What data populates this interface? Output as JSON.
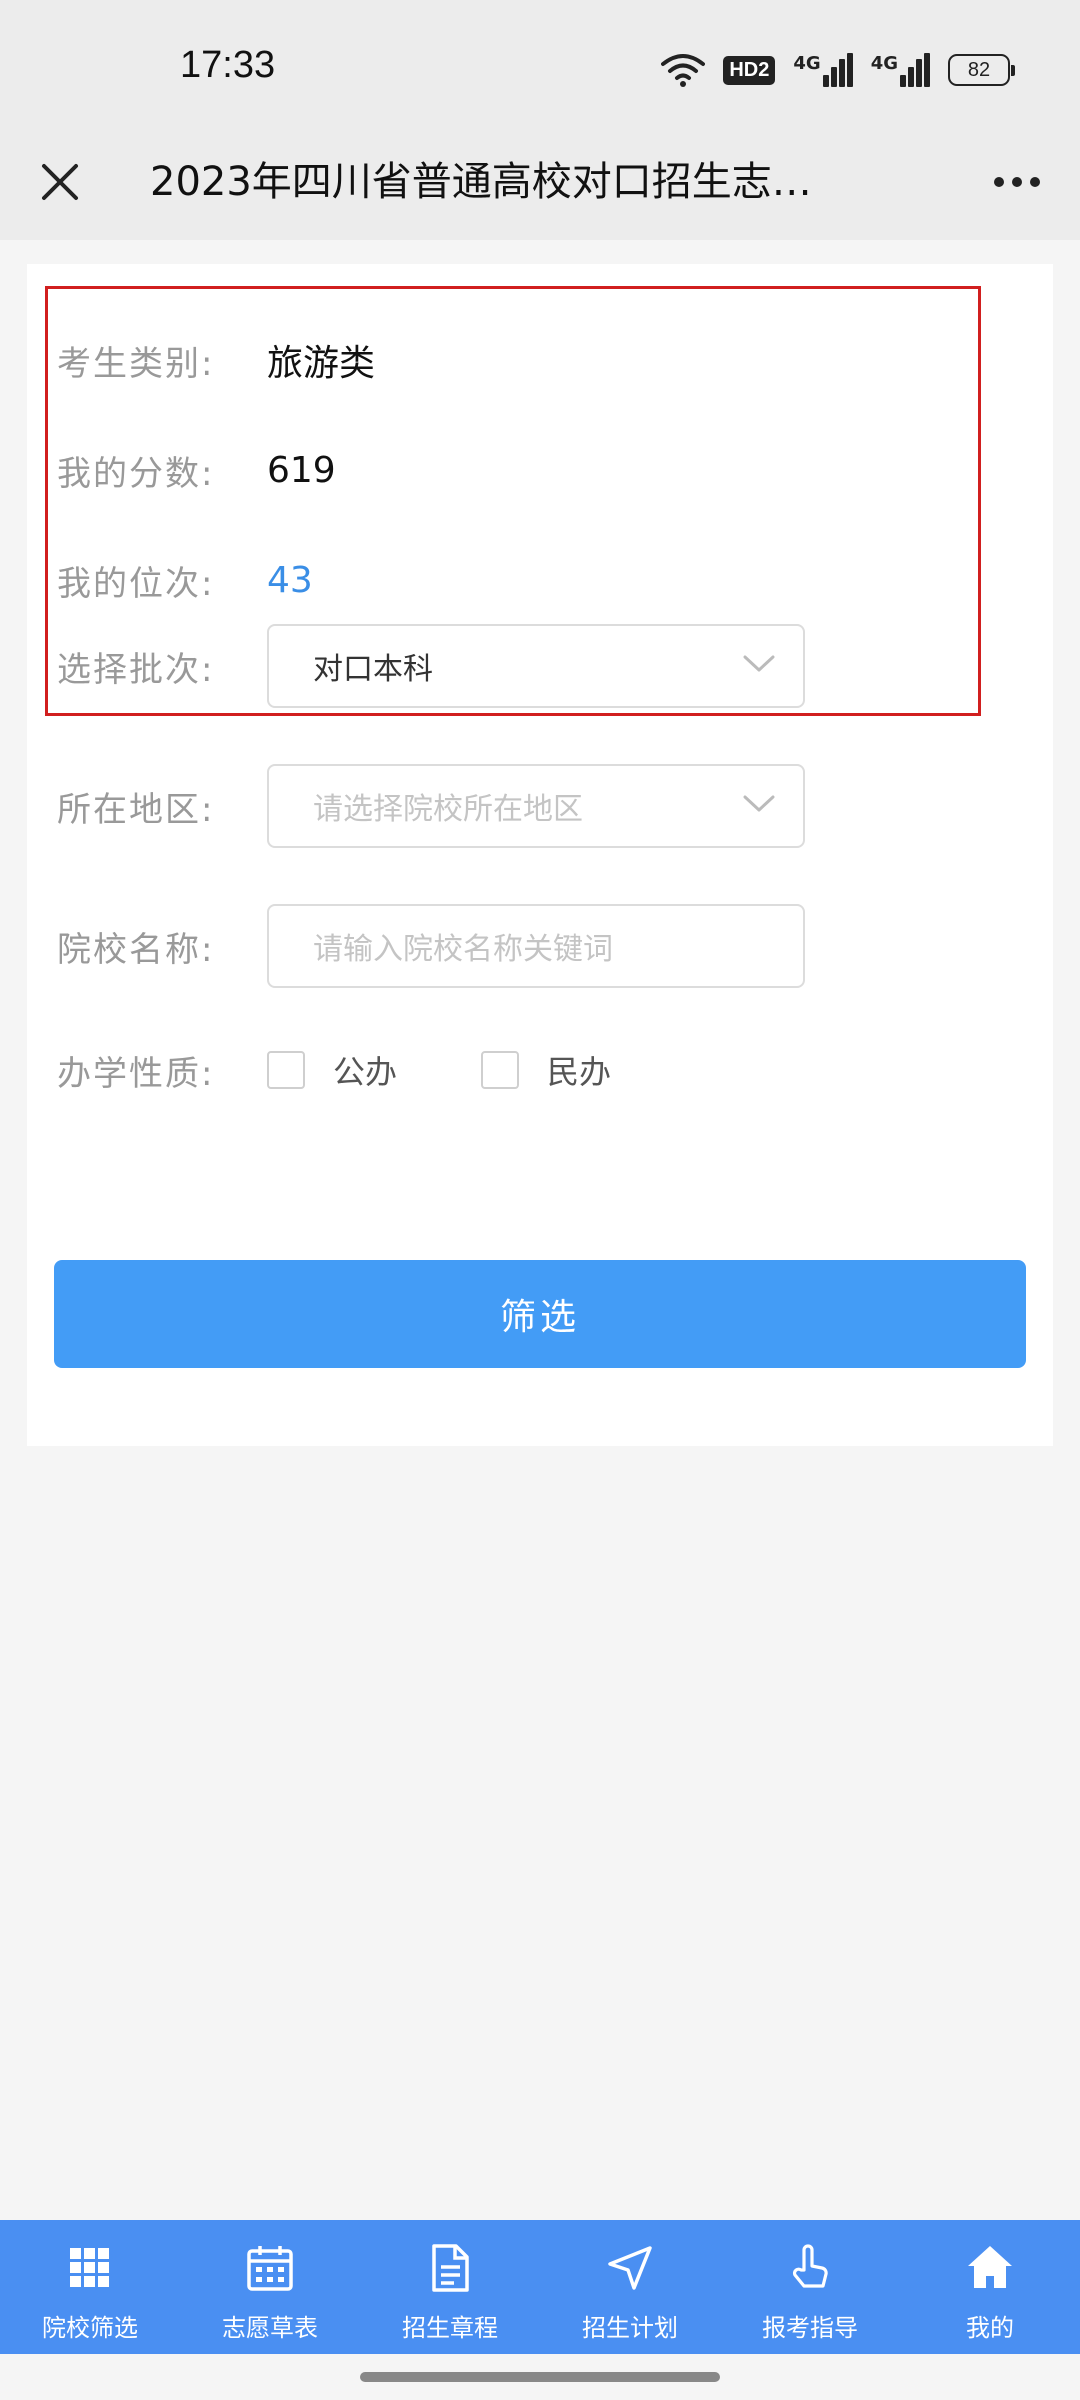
{
  "status_bar": {
    "time": "17:33",
    "hd_label": "HD2",
    "network_1": "4G",
    "network_2": "4G",
    "battery": "82",
    "icons": [
      "wifi-icon",
      "hd-icon",
      "signal-icon",
      "signal-icon",
      "battery-icon"
    ]
  },
  "header": {
    "title": "2023年四川省普通高校对口招生志…",
    "close_icon": "close-icon",
    "more_icon": "more-icon"
  },
  "form": {
    "category_label": "考生类别:",
    "category_value": "旅游类",
    "score_label": "我的分数:",
    "score_value": "619",
    "rank_label": "我的位次:",
    "rank_value": "43",
    "batch_label": "选择批次:",
    "batch_value": "对口本科",
    "region_label": "所在地区:",
    "region_placeholder": "请选择院校所在地区",
    "school_label": "院校名称:",
    "school_placeholder": "请输入院校名称关键词",
    "nature_label": "办学性质:",
    "public_label": "公办",
    "private_label": "民办",
    "submit_label": "筛选"
  },
  "colors": {
    "accent": "#439cf6",
    "nav": "#4a8ff2",
    "highlight": "#d11f1f",
    "rank": "#3a8ee6"
  },
  "nav": {
    "items": [
      {
        "label": "院校筛选",
        "icon": "grid-icon"
      },
      {
        "label": "志愿草表",
        "icon": "calendar-icon"
      },
      {
        "label": "招生章程",
        "icon": "document-icon"
      },
      {
        "label": "招生计划",
        "icon": "navigation-icon"
      },
      {
        "label": "报考指导",
        "icon": "pointer-hand-icon"
      },
      {
        "label": "我的",
        "icon": "home-icon"
      }
    ]
  }
}
